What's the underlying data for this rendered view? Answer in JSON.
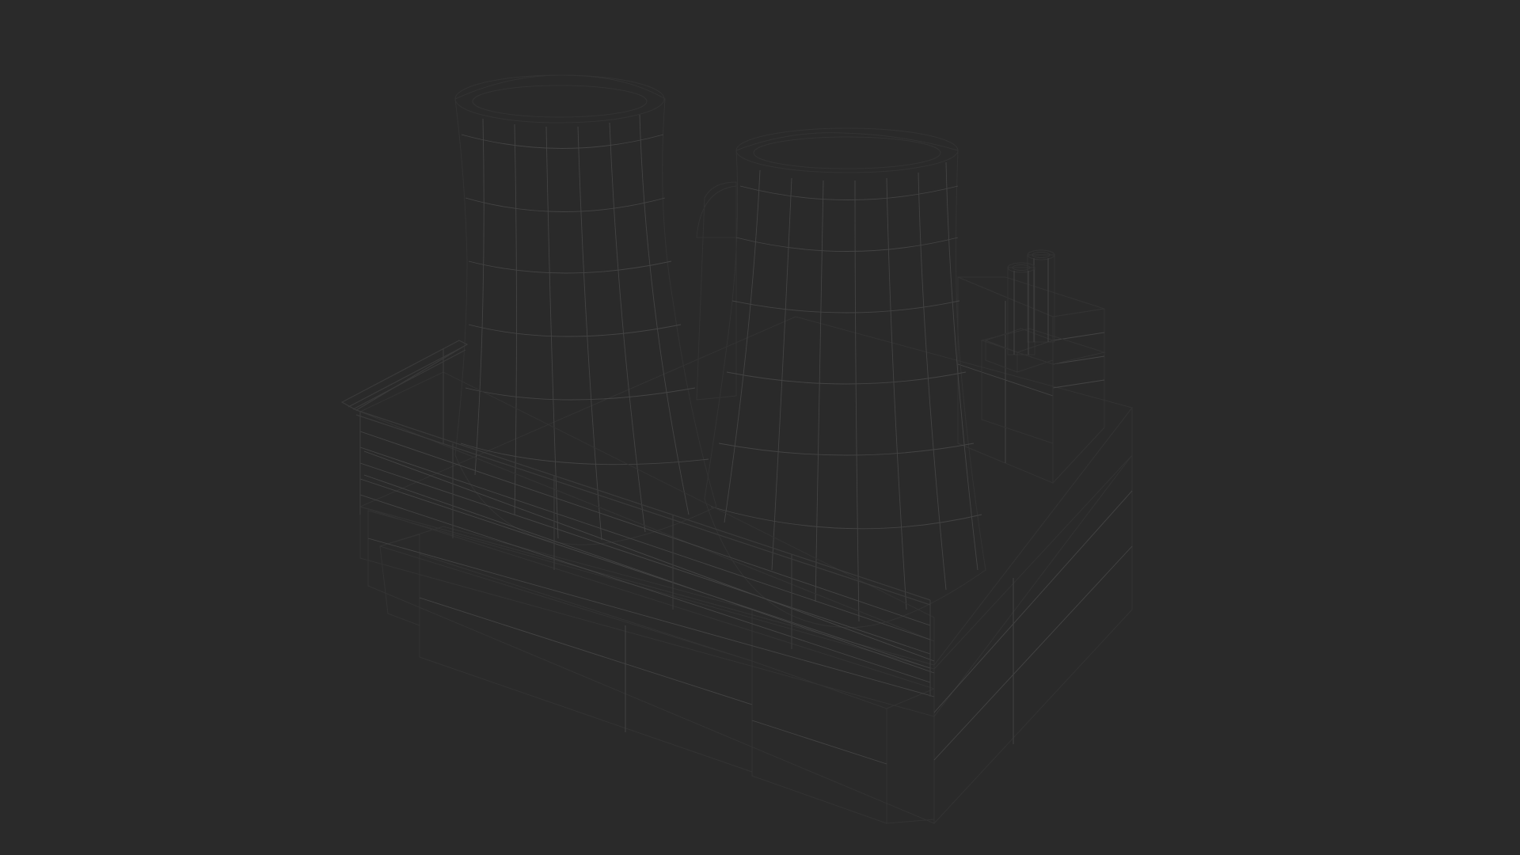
{
  "viewport": {
    "background": "#2a2a2a"
  },
  "model": {
    "subject": "power-plant-wireframe-model",
    "shading": "clay",
    "wireframe_overlay": true,
    "colors": {
      "surface": "#e6e6e6",
      "wire": "#3a3a3a"
    }
  }
}
